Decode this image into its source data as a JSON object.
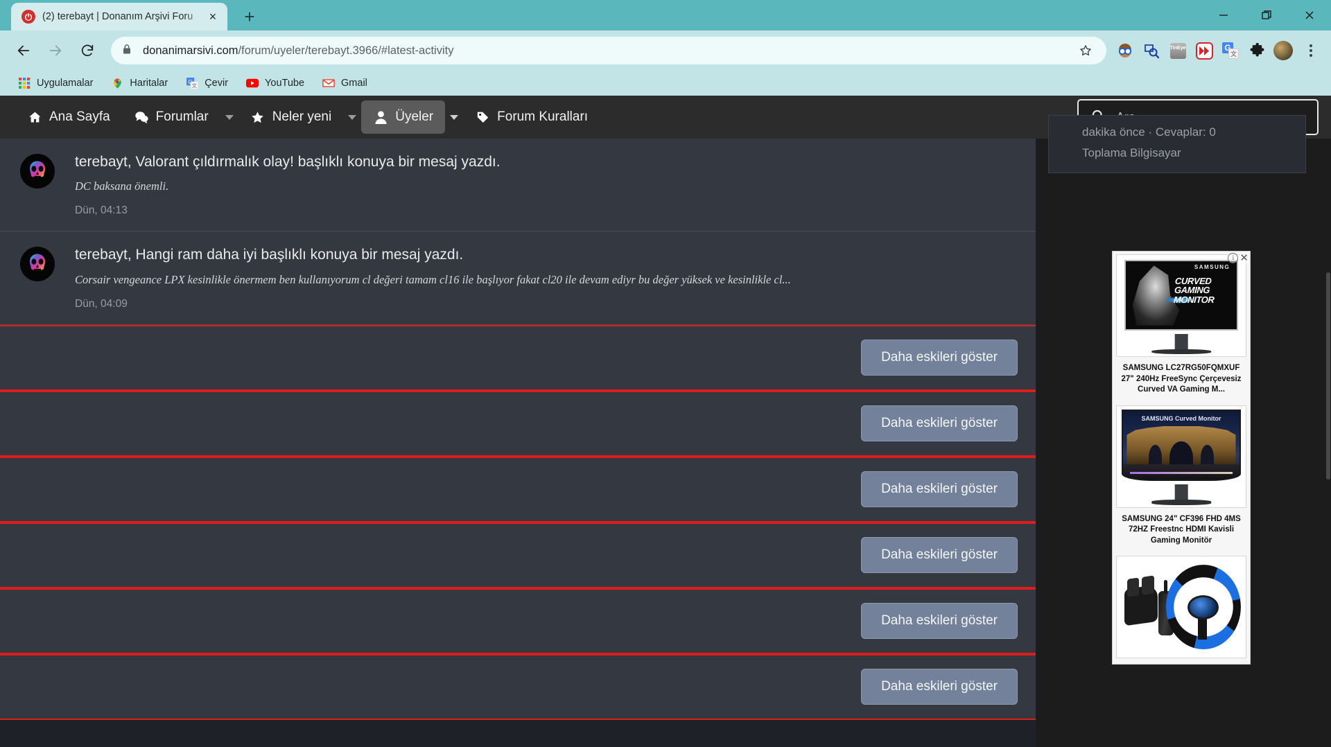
{
  "browser": {
    "tab": {
      "title": "(2) terebayt | Donanım Arşivi Foru",
      "favicon": "power-logo-icon",
      "close": "×"
    },
    "new_tab": "+",
    "window_controls": {
      "minimize": "minimize-icon",
      "maximize": "maximize-icon",
      "close": "close-icon"
    },
    "nav": {
      "back": "back-arrow-icon",
      "forward": "forward-arrow-icon",
      "reload": "reload-icon"
    },
    "omnibox": {
      "lock": "lock-icon",
      "host": "donanimarsivi.com",
      "path": "/forum/uyeler/terebayt.3966/#latest-activity",
      "bookmark_star": "star-icon"
    },
    "extensions": [
      {
        "name": "person-with-glasses-icon",
        "glyph": "🤓"
      },
      {
        "name": "image-search-icon",
        "glyph": ""
      },
      {
        "name": "tineye-icon",
        "label": "TinEye"
      },
      {
        "name": "fast-forward-icon",
        "glyph": "▶▶"
      },
      {
        "name": "google-translate-icon",
        "g": "G",
        "t": "文"
      },
      {
        "name": "puzzle-piece-icon",
        "glyph": "🧩"
      },
      {
        "name": "profile-avatar",
        "glyph": ""
      }
    ],
    "menu": "three-dots-menu-icon",
    "bookmarks": [
      {
        "label": "Uygulamalar",
        "icon": "apps-grid-icon"
      },
      {
        "label": "Haritalar",
        "icon": "maps-pin-icon"
      },
      {
        "label": "Çevir",
        "icon": "translate-icon"
      },
      {
        "label": "YouTube",
        "icon": "youtube-icon"
      },
      {
        "label": "Gmail",
        "icon": "gmail-icon"
      }
    ]
  },
  "forum": {
    "nav": [
      {
        "label": "Ana Sayfa",
        "icon": "home-icon",
        "active": false,
        "caret": false
      },
      {
        "label": "Forumlar",
        "icon": "chat-bubbles-icon",
        "active": false,
        "caret": true
      },
      {
        "label": "Neler yeni",
        "icon": "star-icon",
        "active": false,
        "caret": true
      },
      {
        "label": "Üyeler",
        "icon": "person-icon",
        "active": true,
        "caret": true
      },
      {
        "label": "Forum Kuralları",
        "icon": "tag-icon",
        "active": false,
        "caret": false
      }
    ],
    "search": {
      "placeholder": "Ara...",
      "value": "",
      "icon": "search-icon"
    },
    "activity": [
      {
        "title": "terebayt, Valorant çıldırmalık olay! başlıklı konuya bir mesaj yazdı.",
        "snippet": "DC baksana önemli.",
        "time": "Dün, 04:13",
        "avatar": "skull-avatar"
      },
      {
        "title": "terebayt, Hangi ram daha iyi başlıklı konuya bir mesaj yazdı.",
        "snippet": "Corsair vengeance LPX kesinlikle önermem ben kullanıyorum cl değeri tamam cl16 ile başlıyor fakat cl20 ile devam ediyr bu değer yüksek ve kesinlikle cl...",
        "time": "Dün, 04:09",
        "avatar": "skull-avatar"
      }
    ],
    "older_button_label": "Daha eskileri göster",
    "older_button_count": 6,
    "sidebar_card": {
      "line1": "dakika önce · Cevaplar: 0",
      "line2": "Toplama Bilgisayar"
    }
  },
  "ads": {
    "info_icon": "adchoices-info-icon",
    "close_icon": "adchoices-close-icon",
    "items": [
      {
        "caption": "SAMSUNG LC27RG50FQMXUF 27\" 240Hz FreeSync Çerçevesiz Curved VA Gaming M...",
        "image": "samsung-curved-gaming-monitor-ad",
        "brand": "SAMSUNG",
        "overlay_text": "CURVED GAMING MONITOR"
      },
      {
        "caption": "SAMSUNG 24\" CF396 FHD 4MS 72HZ Freestnc HDMI Kavisli Gaming Monitör",
        "image": "samsung-curved-monitor-city-ad",
        "brand": "SAMSUNG Curved Monitor",
        "overlay_text": ""
      },
      {
        "caption": "",
        "image": "racing-wheel-pedals-ad",
        "brand": "",
        "overlay_text": ""
      }
    ]
  },
  "colors": {
    "chrome_accent": "#5ab8bd",
    "toolbar": "#c3e4e6",
    "forum_nav_bg": "#2c2c2c",
    "content_bg": "#343840",
    "page_bg": "#1c1c1c",
    "separator_red": "#e01b1b",
    "button_bg": "#73819a"
  }
}
